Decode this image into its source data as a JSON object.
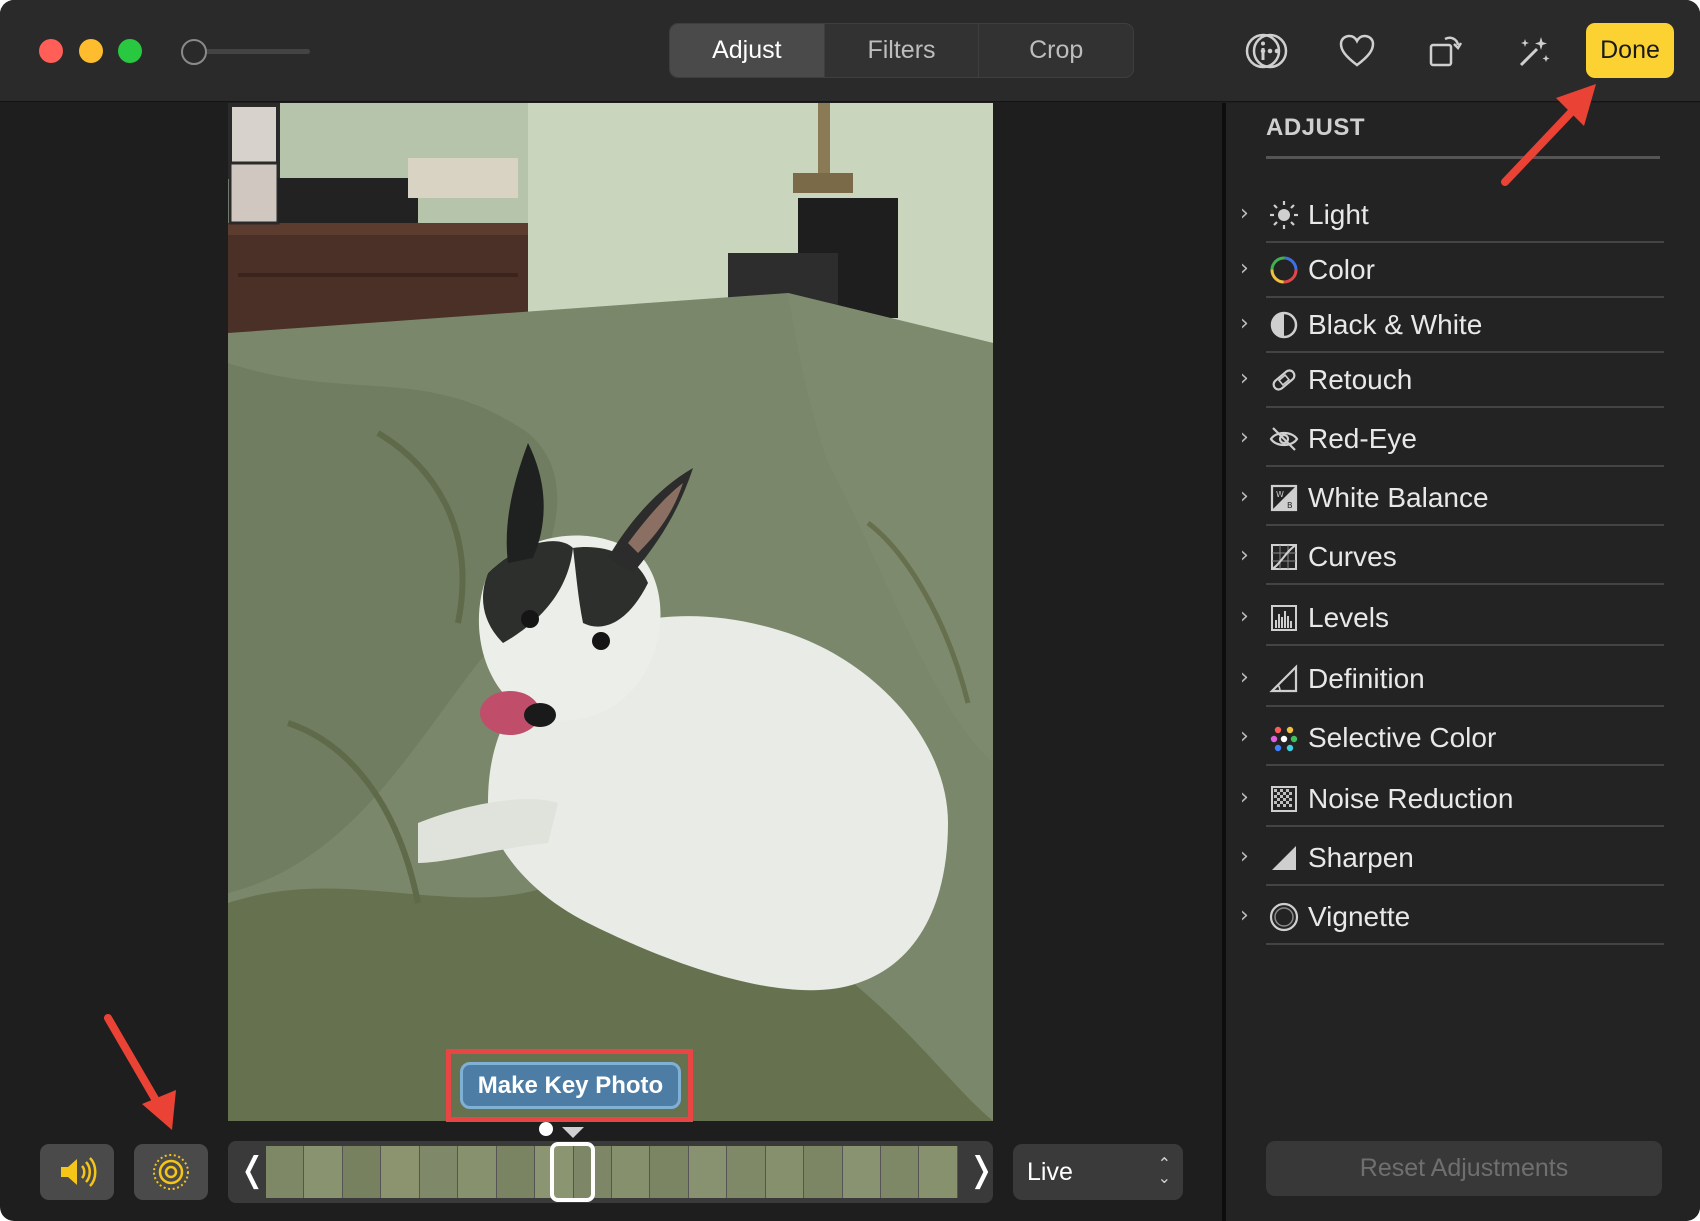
{
  "toolbar": {
    "tabs": [
      {
        "label": "Adjust",
        "active": true
      },
      {
        "label": "Filters",
        "active": false
      },
      {
        "label": "Crop",
        "active": false
      }
    ],
    "icons": [
      "info-icon",
      "more-icon",
      "heart-icon",
      "rotate-icon",
      "magic-wand-icon"
    ],
    "done_label": "Done",
    "done_color": "#fcd232"
  },
  "photo": {
    "key_photo_label": "Make Key Photo"
  },
  "playback": {
    "sound_icon": "speaker-icon",
    "live_icon": "live-photo-icon",
    "live_mode": "Live"
  },
  "sidebar": {
    "title": "ADJUST",
    "items": [
      {
        "label": "Light",
        "icon": "sun-icon"
      },
      {
        "label": "Color",
        "icon": "color-wheel-icon"
      },
      {
        "label": "Black & White",
        "icon": "half-circle-icon"
      },
      {
        "label": "Retouch",
        "icon": "bandage-icon"
      },
      {
        "label": "Red-Eye",
        "icon": "eye-slash-icon"
      },
      {
        "label": "White Balance",
        "icon": "white-balance-icon"
      },
      {
        "label": "Curves",
        "icon": "curves-icon"
      },
      {
        "label": "Levels",
        "icon": "levels-icon"
      },
      {
        "label": "Definition",
        "icon": "triangle-icon"
      },
      {
        "label": "Selective Color",
        "icon": "color-dots-icon"
      },
      {
        "label": "Noise Reduction",
        "icon": "noise-icon"
      },
      {
        "label": "Sharpen",
        "icon": "sharpen-icon"
      },
      {
        "label": "Vignette",
        "icon": "vignette-icon"
      }
    ],
    "reset_label": "Reset Adjustments"
  },
  "colors": {
    "annotation": "#ea4335",
    "highlight_box": "#e84545",
    "key_photo_button": "#4d7da5"
  }
}
